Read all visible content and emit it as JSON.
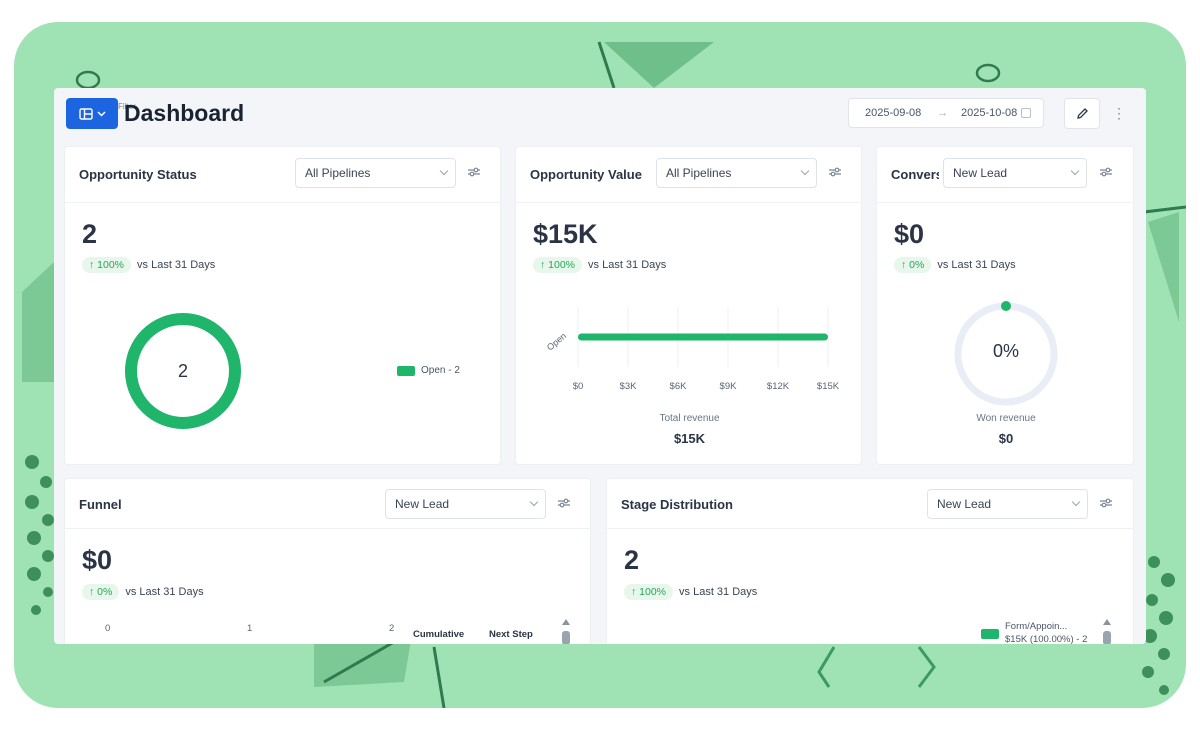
{
  "page": {
    "title": "Dashboard",
    "tiny_label": "Filter"
  },
  "date_range": {
    "start": "2025-09-08",
    "arrow": "→",
    "end": "2025-10-08"
  },
  "icons": {
    "layout": "layout-grid-icon",
    "edit": "pencil-icon",
    "more": "kebab-menu-icon",
    "filter": "sliders-icon",
    "calendar": "calendar-icon"
  },
  "colors": {
    "accent": "#1d64e0",
    "green": "#1fb56a",
    "frame": "#9fe3b4"
  },
  "cards": {
    "opportunity_status": {
      "title": "Opportunity Status",
      "select": "All Pipelines",
      "value": "2",
      "change": "↑ 100%",
      "period": "vs Last 31 Days",
      "donut_center": "2",
      "legend": "Open - 2",
      "donut_fill": 1.0
    },
    "opportunity_value": {
      "title": "Opportunity Value",
      "select": "All Pipelines",
      "value": "$15K",
      "change": "↑ 100%",
      "period": "vs Last 31 Days",
      "footer_label": "Total revenue",
      "footer_value": "$15K"
    },
    "conversion": {
      "title": "Convers",
      "select": "New Lead",
      "value": "$0",
      "change": "↑ 0%",
      "period": "vs Last 31 Days",
      "gauge_center": "0%",
      "gauge_fill": 0,
      "footer_label": "Won revenue",
      "footer_value": "$0"
    },
    "funnel": {
      "title": "Funnel",
      "select": "New Lead",
      "value": "$0",
      "change": "↑ 0%",
      "period": "vs Last 31 Days",
      "axis_ticks": [
        "0",
        "1",
        "2"
      ],
      "col_cumulative": "Cumulative",
      "col_next": "Next Step"
    },
    "stage_distribution": {
      "title": "Stage Distribution",
      "select": "New Lead",
      "value": "2",
      "change": "↑ 100%",
      "period": "vs Last 31 Days",
      "legend_line1": "Form/Appoin...",
      "legend_line2": "$15K (100.00%) - 2"
    }
  },
  "chart_data": {
    "type": "bar",
    "orientation": "horizontal",
    "categories": [
      "Open"
    ],
    "values": [
      15000
    ],
    "x_ticks": [
      "$0",
      "$3K",
      "$6K",
      "$9K",
      "$12K",
      "$15K"
    ],
    "xlim": [
      0,
      15000
    ],
    "grid": true
  }
}
